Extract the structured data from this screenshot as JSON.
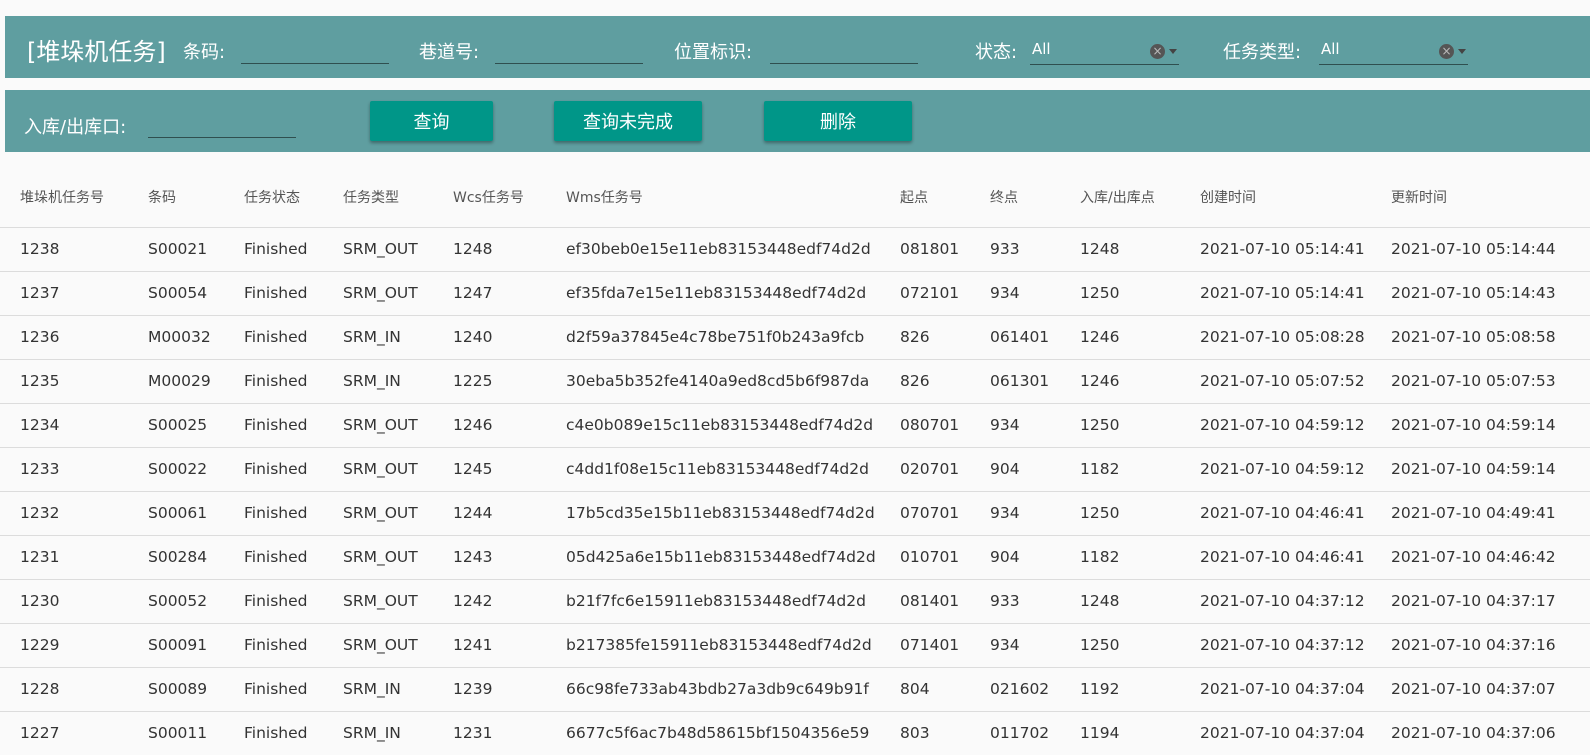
{
  "header": {
    "title": "[堆垛机任务]",
    "filters": {
      "barcode_label": "条码:",
      "lane_label": "巷道号:",
      "position_label": "位置标识:",
      "status_label": "状态:",
      "status_value": "All",
      "task_type_label": "任务类型:",
      "task_type_value": "All",
      "port_label": "入库/出库口:"
    }
  },
  "actions": {
    "query_label": "查询",
    "query_unfinished_label": "查询未完成",
    "delete_label": "删除"
  },
  "table": {
    "columns": [
      "堆垛机任务号",
      "条码",
      "任务状态",
      "任务类型",
      "Wcs任务号",
      "Wms任务号",
      "起点",
      "终点",
      "入库/出库点",
      "创建时间",
      "更新时间"
    ],
    "rows": [
      [
        "1238",
        "S00021",
        "Finished",
        "SRM_OUT",
        "1248",
        "ef30beb0e15e11eb83153448edf74d2d",
        "081801",
        "933",
        "1248",
        "2021-07-10 05:14:41",
        "2021-07-10 05:14:44"
      ],
      [
        "1237",
        "S00054",
        "Finished",
        "SRM_OUT",
        "1247",
        "ef35fda7e15e11eb83153448edf74d2d",
        "072101",
        "934",
        "1250",
        "2021-07-10 05:14:41",
        "2021-07-10 05:14:43"
      ],
      [
        "1236",
        "M00032",
        "Finished",
        "SRM_IN",
        "1240",
        "d2f59a37845e4c78be751f0b243a9fcb",
        "826",
        "061401",
        "1246",
        "2021-07-10 05:08:28",
        "2021-07-10 05:08:58"
      ],
      [
        "1235",
        "M00029",
        "Finished",
        "SRM_IN",
        "1225",
        "30eba5b352fe4140a9ed8cd5b6f987da",
        "826",
        "061301",
        "1246",
        "2021-07-10 05:07:52",
        "2021-07-10 05:07:53"
      ],
      [
        "1234",
        "S00025",
        "Finished",
        "SRM_OUT",
        "1246",
        "c4e0b089e15c11eb83153448edf74d2d",
        "080701",
        "934",
        "1250",
        "2021-07-10 04:59:12",
        "2021-07-10 04:59:14"
      ],
      [
        "1233",
        "S00022",
        "Finished",
        "SRM_OUT",
        "1245",
        "c4dd1f08e15c11eb83153448edf74d2d",
        "020701",
        "904",
        "1182",
        "2021-07-10 04:59:12",
        "2021-07-10 04:59:14"
      ],
      [
        "1232",
        "S00061",
        "Finished",
        "SRM_OUT",
        "1244",
        "17b5cd35e15b11eb83153448edf74d2d",
        "070701",
        "934",
        "1250",
        "2021-07-10 04:46:41",
        "2021-07-10 04:49:41"
      ],
      [
        "1231",
        "S00284",
        "Finished",
        "SRM_OUT",
        "1243",
        "05d425a6e15b11eb83153448edf74d2d",
        "010701",
        "904",
        "1182",
        "2021-07-10 04:46:41",
        "2021-07-10 04:46:42"
      ],
      [
        "1230",
        "S00052",
        "Finished",
        "SRM_OUT",
        "1242",
        "b21f7fc6e15911eb83153448edf74d2d",
        "081401",
        "933",
        "1248",
        "2021-07-10 04:37:12",
        "2021-07-10 04:37:17"
      ],
      [
        "1229",
        "S00091",
        "Finished",
        "SRM_OUT",
        "1241",
        "b217385fe15911eb83153448edf74d2d",
        "071401",
        "934",
        "1250",
        "2021-07-10 04:37:12",
        "2021-07-10 04:37:16"
      ],
      [
        "1228",
        "S00089",
        "Finished",
        "SRM_IN",
        "1239",
        "66c98fe733ab43bdb27a3db9c649b91f",
        "804",
        "021602",
        "1192",
        "2021-07-10 04:37:04",
        "2021-07-10 04:37:07"
      ],
      [
        "1227",
        "S00011",
        "Finished",
        "SRM_IN",
        "1231",
        "6677c5f6ac7b48d58615bf1504356e59",
        "803",
        "011702",
        "1194",
        "2021-07-10 04:37:04",
        "2021-07-10 04:37:06"
      ]
    ]
  },
  "colors": {
    "header_bar": "#5f9ea0",
    "button": "#009688"
  },
  "icons": {
    "clear": "clear-icon",
    "dropdown": "chevron-down-icon"
  }
}
